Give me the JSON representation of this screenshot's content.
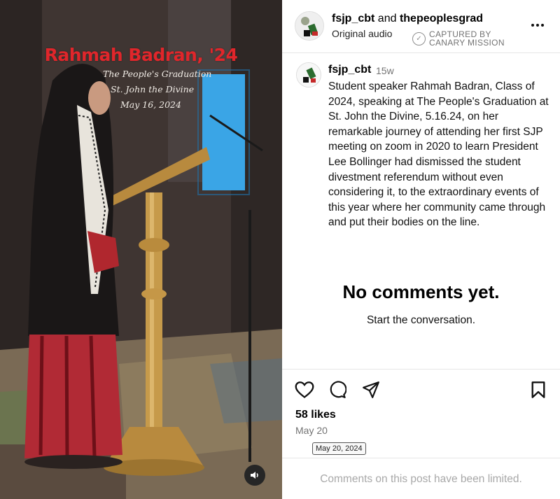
{
  "media": {
    "overlay_title": "Rahmah Badran, '24",
    "overlay_line1": "The People's Graduation",
    "overlay_line2": "St. John the Divine",
    "overlay_line3": "May 16, 2024",
    "audio_icon": "speaker-icon"
  },
  "header": {
    "user1": "fsjp_cbt",
    "joiner": " and ",
    "user2": "thepeoplesgrad",
    "audio": "Original audio",
    "captured_line1": "CAPTURED BY",
    "captured_line2": "CANARY MISSION",
    "more_icon": "more-options-icon"
  },
  "caption": {
    "username": "fsjp_cbt",
    "time": "15w",
    "text": "Student speaker Rahmah Badran, Class of 2024, speaking at The People's Graduation at St. John the Divine, 5.16.24, on her remarkable journey of attending her first SJP meeting on zoom in 2020 to learn President Lee Bollinger had dismissed the student divestment referendum without even considering it, to the extraordinary events of this year where her community came through and put their bodies on the line."
  },
  "comments": {
    "empty_title": "No comments yet.",
    "empty_sub": "Start the conversation."
  },
  "actions": {
    "like_icon": "heart-icon",
    "comment_icon": "comment-icon",
    "share_icon": "share-icon",
    "save_icon": "bookmark-icon",
    "likes": "58 likes",
    "date": "May 20",
    "date_tooltip": "May 20, 2024"
  },
  "footer": {
    "limited_text": "Comments on this post have been limited."
  },
  "colors": {
    "overlay_title": "#e0262b",
    "muted": "#737373",
    "border": "#e6e6e6"
  }
}
